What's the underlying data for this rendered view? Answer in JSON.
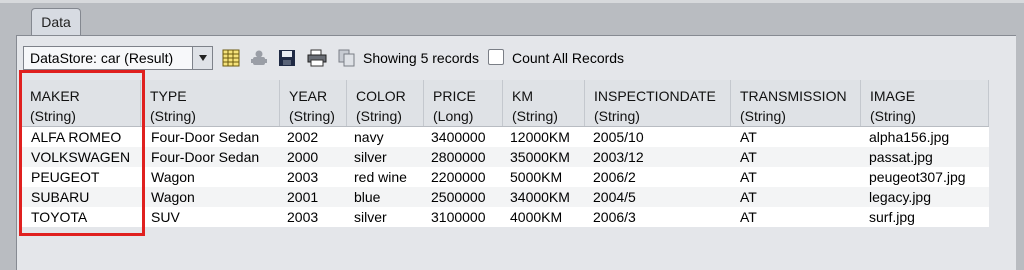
{
  "tabs": [
    {
      "label": "Data"
    }
  ],
  "toolbar": {
    "datastore_select": "DataStore: car (Result)",
    "showing_text": "Showing 5 records",
    "count_all_label": "Count All Records",
    "count_all_checked": false
  },
  "table": {
    "columns": [
      {
        "name": "MAKER",
        "type": "(String)"
      },
      {
        "name": "TYPE",
        "type": "(String)"
      },
      {
        "name": "YEAR",
        "type": "(String)"
      },
      {
        "name": "COLOR",
        "type": "(String)"
      },
      {
        "name": "PRICE",
        "type": "(Long)"
      },
      {
        "name": "KM",
        "type": "(String)"
      },
      {
        "name": "INSPECTIONDATE",
        "type": "(String)"
      },
      {
        "name": "TRANSMISSION",
        "type": "(String)"
      },
      {
        "name": "IMAGE",
        "type": "(String)"
      }
    ],
    "rows": [
      [
        "ALFA ROMEO",
        "Four-Door Sedan",
        "2002",
        "navy",
        "3400000",
        "12000KM",
        "2005/10",
        "AT",
        "alpha156.jpg"
      ],
      [
        "VOLKSWAGEN",
        "Four-Door Sedan",
        "2000",
        "silver",
        "2800000",
        "35000KM",
        "2003/12",
        "AT",
        "passat.jpg"
      ],
      [
        "PEUGEOT",
        "Wagon",
        "2003",
        "red wine",
        "2200000",
        "5000KM",
        "2006/2",
        "AT",
        "peugeot307.jpg"
      ],
      [
        "SUBARU",
        "Wagon",
        "2001",
        "blue",
        "2500000",
        "34000KM",
        "2004/5",
        "AT",
        "legacy.jpg"
      ],
      [
        "TOYOTA",
        "SUV",
        "2003",
        "silver",
        "3100000",
        "4000KM",
        "2006/3",
        "AT",
        "surf.jpg"
      ]
    ]
  },
  "colors": {
    "highlight": "#e0201f"
  }
}
